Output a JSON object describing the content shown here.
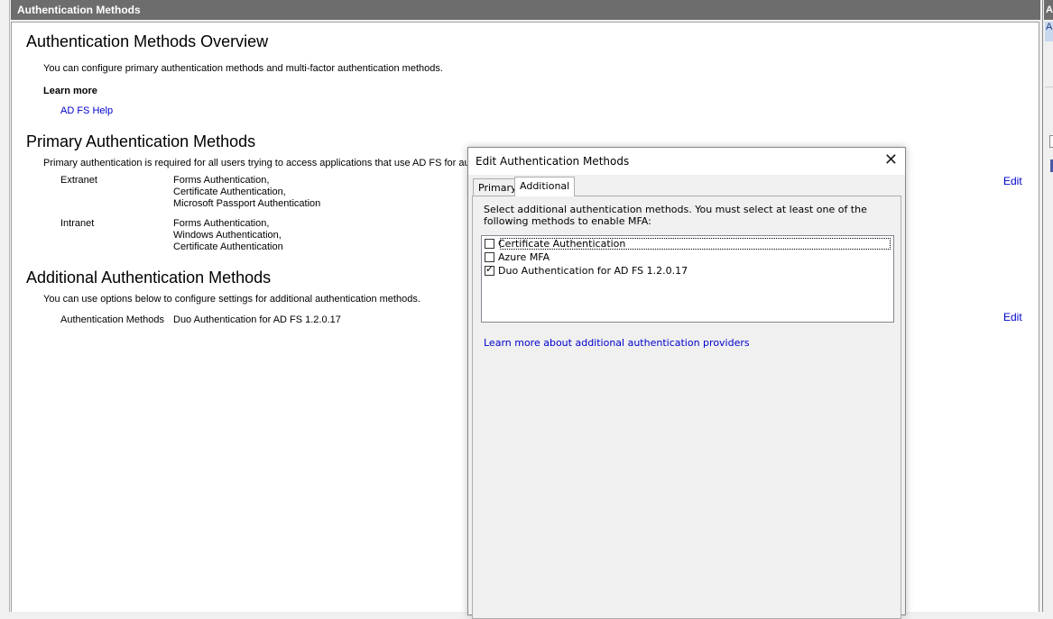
{
  "pane": {
    "title": "Authentication Methods"
  },
  "overview": {
    "heading": "Authentication Methods Overview",
    "description": "You can configure primary authentication methods and multi-factor authentication methods.",
    "learn_more": "Learn more",
    "help_link": "AD FS Help"
  },
  "primary": {
    "heading": "Primary Authentication Methods",
    "description": "Primary authentication is required for all users trying to access applications that use AD FS for authen",
    "edit_label": "Edit",
    "extranet": {
      "label": "Extranet",
      "methods": [
        "Forms Authentication,",
        "Certificate Authentication,",
        "Microsoft Passport Authentication"
      ]
    },
    "intranet": {
      "label": "Intranet",
      "methods": [
        "Forms Authentication,",
        "Windows Authentication,",
        "Certificate Authentication"
      ]
    }
  },
  "additional": {
    "heading": "Additional Authentication Methods",
    "description": "You can use options below to configure settings for additional authentication methods.",
    "methods_label": "Authentication Methods",
    "methods_value": "Duo Authentication for AD FS 1.2.0.17",
    "edit_label": "Edit"
  },
  "right_panel": {
    "title_fragment": "A",
    "selected_fragment": "A"
  },
  "dialog": {
    "title": "Edit Authentication Methods",
    "close_glyph": "✕",
    "tabs": [
      {
        "label": "Primary",
        "active": false
      },
      {
        "label": "Additional",
        "active": true
      }
    ],
    "instructions": "Select additional authentication methods. You must select at least one of the following methods to enable MFA:",
    "methods": [
      {
        "label": "Certificate Authentication",
        "checked": false
      },
      {
        "label": "Azure MFA",
        "checked": false
      },
      {
        "label": "Duo Authentication for AD FS 1.2.0.17",
        "checked": true
      }
    ],
    "check_glyph": "✓",
    "learn_more_link": "Learn more about additional authentication providers"
  }
}
